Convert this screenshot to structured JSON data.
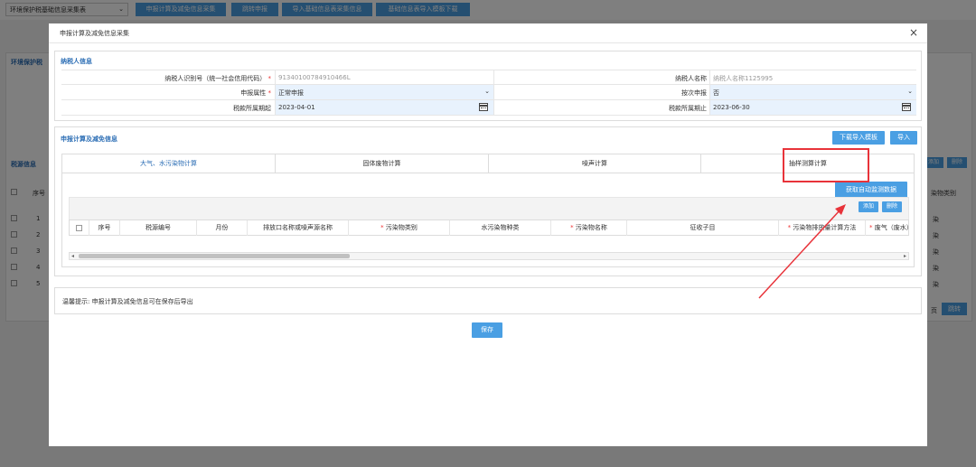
{
  "background": {
    "select_value": "环境保护税基础信息采集表",
    "toolbar": [
      "申报计算及减免信息采集",
      "跳转申报",
      "导入基础信息表采集信息",
      "基础信息表导入模板下载"
    ],
    "panel_title": "环境保护税",
    "source_info": "税源信息",
    "col_seq": "序号",
    "col_right": "染物类别",
    "rows": [
      "1",
      "2",
      "3",
      "4",
      "5"
    ],
    "row_value": "染",
    "add_label": "添加",
    "delete_label": "删除",
    "page_label": "页",
    "jump_label": "跳转"
  },
  "modal": {
    "title": "申报计算及减免信息采集",
    "close": "×",
    "taxpayer": {
      "section_title": "纳税人信息",
      "id_label": "纳税人识别号（统一社会信用代码）",
      "id_value": "91340100784910466L",
      "name_label": "纳税人名称",
      "name_value": "纳税人名称1125995",
      "attr_label": "申报属性",
      "attr_value": "正常申报",
      "by_time_label": "按次申报",
      "by_time_value": "否",
      "start_label": "税款所属期起",
      "start_value": "2023-04-01",
      "end_label": "税款所属期止",
      "end_value": "2023-06-30"
    },
    "calc": {
      "section_title": "申报计算及减免信息",
      "download_template": "下载导入模板",
      "import": "导入",
      "tabs": [
        "大气、水污染物计算",
        "固体废物计算",
        "噪声计算",
        "抽样测算计算"
      ],
      "fetch_button": "获取自动监测数据",
      "add": "添加",
      "delete": "删除",
      "columns": [
        "序号",
        "税源编号",
        "月份",
        "排放口名称或噪声源名称",
        "污染物类别",
        "水污染物种类",
        "污染物名称",
        "征收子目",
        "污染物排放量计算方法",
        "废气（废水）排放量"
      ],
      "required": [
        false,
        false,
        false,
        false,
        true,
        false,
        true,
        false,
        true,
        true
      ]
    },
    "tip": "温馨提示: 申报计算及减免信息可在保存后导出",
    "save": "保存"
  },
  "colors": {
    "accent": "#4a9fe3",
    "section_title": "#2c6eb5",
    "highlight": "#e8333a"
  }
}
